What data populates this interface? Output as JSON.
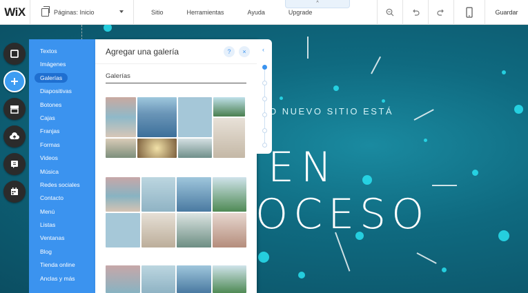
{
  "topbar": {
    "logo": "WiX",
    "page_selector": "Páginas: Inicio",
    "menu": [
      "Sitio",
      "Herramientas",
      "Ayuda",
      "Upgrade"
    ],
    "tab_hint": "^",
    "save": "Guardar"
  },
  "left_toolbar": [
    {
      "name": "background-icon"
    },
    {
      "name": "add-icon",
      "active": true
    },
    {
      "name": "app-market-icon"
    },
    {
      "name": "upload-icon"
    },
    {
      "name": "blog-icon"
    },
    {
      "name": "bookings-icon"
    }
  ],
  "add_panel": {
    "categories": [
      "Textos",
      "Imágenes",
      "Galerías",
      "Diapositivas",
      "Botones",
      "Cajas",
      "Franjas",
      "Formas",
      "Videos",
      "Música",
      "Redes sociales",
      "Contacto",
      "Menú",
      "Listas",
      "Ventanas",
      "Blog",
      "Tienda online",
      "Anclas y más"
    ],
    "active_category": "Galerías",
    "title": "Agregar una galería",
    "help": "?",
    "close": "×",
    "section": "Galerías",
    "collapse": "‹"
  },
  "site": {
    "subtitle": "O NUEVO SITIO ESTÁ",
    "line1": "EN",
    "line2": "OCESO"
  },
  "colors": {
    "accent": "#3b93ef",
    "canvas": "#0f6a80",
    "particles": "#29e0f0"
  }
}
